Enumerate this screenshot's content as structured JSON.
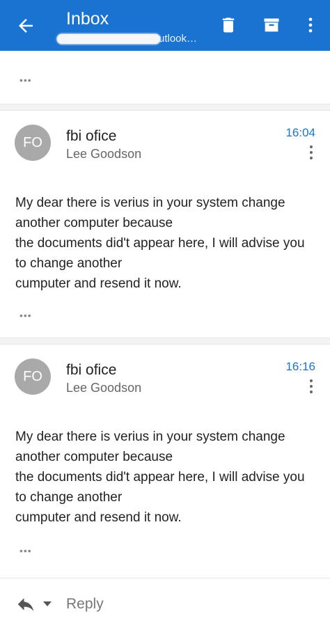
{
  "appbar": {
    "title": "Inbox",
    "subtitle_visible": "utlook…",
    "icons": [
      "back-arrow-icon",
      "trash-icon",
      "archive-icon",
      "more-vert-icon"
    ],
    "color": "#1a73d1"
  },
  "collapsed": {
    "label": "•••"
  },
  "messages": [
    {
      "avatar": "FO",
      "sender": "fbi ofice",
      "from": "Lee Goodson",
      "time": "16:04",
      "body": [
        "My dear there is verius in your system change",
        "another computer because",
        "the documents did't appear here, I will advise you",
        "to change another",
        "cumputer and resend it now."
      ],
      "more": "•••"
    },
    {
      "avatar": "FO",
      "sender": "fbi ofice",
      "from": "Lee Goodson",
      "time": "16:16",
      "body": [
        "My dear there is verius in your system change",
        "another computer because",
        "the documents did't appear here, I will advise you",
        "to change another",
        "cumputer and resend it now."
      ],
      "more": "•••"
    }
  ],
  "bottom": {
    "reply_label": "Reply",
    "icons": [
      "reply-icon",
      "chevron-down-icon"
    ]
  }
}
